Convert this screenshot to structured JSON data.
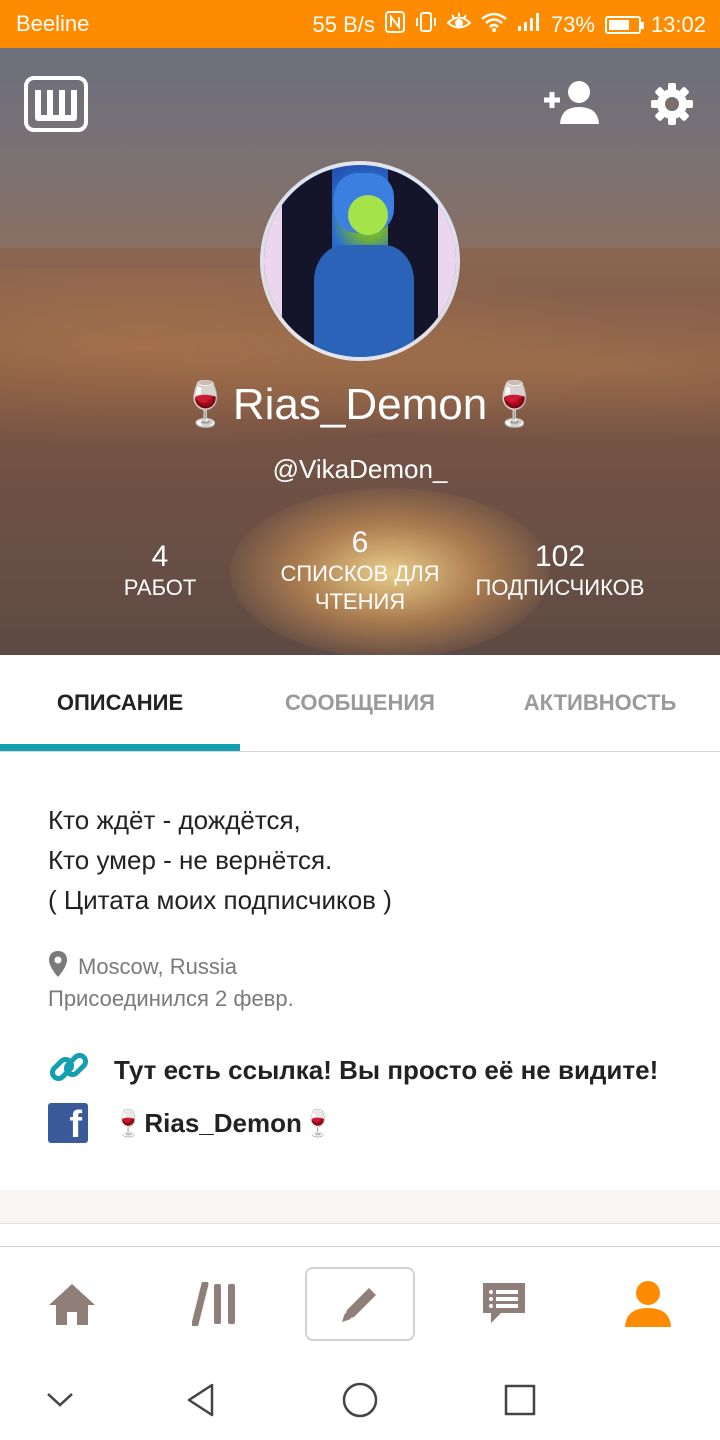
{
  "status_bar": {
    "carrier": "Beeline",
    "speed": "55 B/s",
    "battery": "73%",
    "battery_level": 0.73,
    "time": "13:02"
  },
  "header": {
    "logo_letter": "Ш",
    "display_name": "🍷Rias_Demon🍷",
    "username": "@VikaDemon_",
    "stats": {
      "works_count": "4",
      "works_label": "РАБОТ",
      "lists_count": "6",
      "lists_label": "СПИСКОВ ДЛЯ ЧТЕНИЯ",
      "followers_count": "102",
      "followers_label": "ПОДПИСЧИКОВ"
    },
    "icons": [
      "wattpad-logo-icon",
      "add-user-icon",
      "gear-icon"
    ]
  },
  "tabs": [
    {
      "label": "ОПИСАНИЕ",
      "active": true
    },
    {
      "label": "СООБЩЕНИЯ",
      "active": false
    },
    {
      "label": "АКТИВНОСТЬ",
      "active": false
    }
  ],
  "about": {
    "description_lines": [
      "Кто ждёт - дождётся,",
      "Кто умер - не вернётся.",
      "( Цитата моих подписчиков )"
    ],
    "location": "Moscow, Russia",
    "joined": "Присоединился 2 февр.",
    "link_text": "Тут есть ссылка! Вы просто её не видите!",
    "facebook_name": "🍷Rias_Demon🍷"
  },
  "bottom_nav": {
    "items": [
      "home-icon",
      "library-icon",
      "write-icon",
      "messages-icon",
      "profile-icon"
    ],
    "active": "profile-icon"
  },
  "colors": {
    "status_bar": "#ff8c00",
    "accent_tab": "#12a0b0",
    "link_icon": "#12a0b0",
    "facebook": "#3b5a9a",
    "active_nav": "#ff8c00",
    "inactive_nav": "#8f7f78"
  }
}
